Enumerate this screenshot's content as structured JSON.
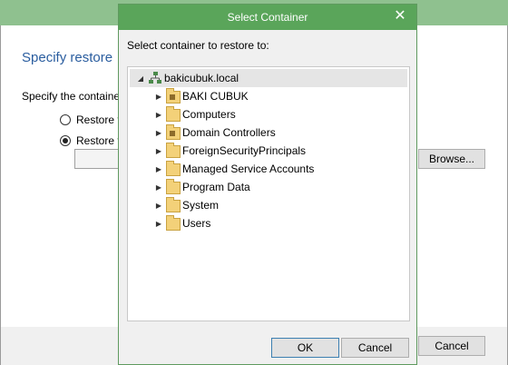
{
  "background_window": {
    "heading": "Specify restore",
    "prompt": "Specify the containe",
    "radio_1_label": "Restore t",
    "radio_2_label": "Restore t",
    "browse_label": "Browse...",
    "cancel_label": "Cancel"
  },
  "dialog": {
    "title": "Select Container",
    "close_glyph": "✕",
    "prompt": "Select container to restore to:",
    "tree": {
      "root": "bakicubuk.local",
      "children": [
        "BAKI CUBUK",
        "Computers",
        "Domain Controllers",
        "ForeignSecurityPrincipals",
        "Managed Service Accounts",
        "Program Data",
        "System",
        "Users"
      ]
    },
    "ok_label": "OK",
    "cancel_label": "Cancel"
  }
}
